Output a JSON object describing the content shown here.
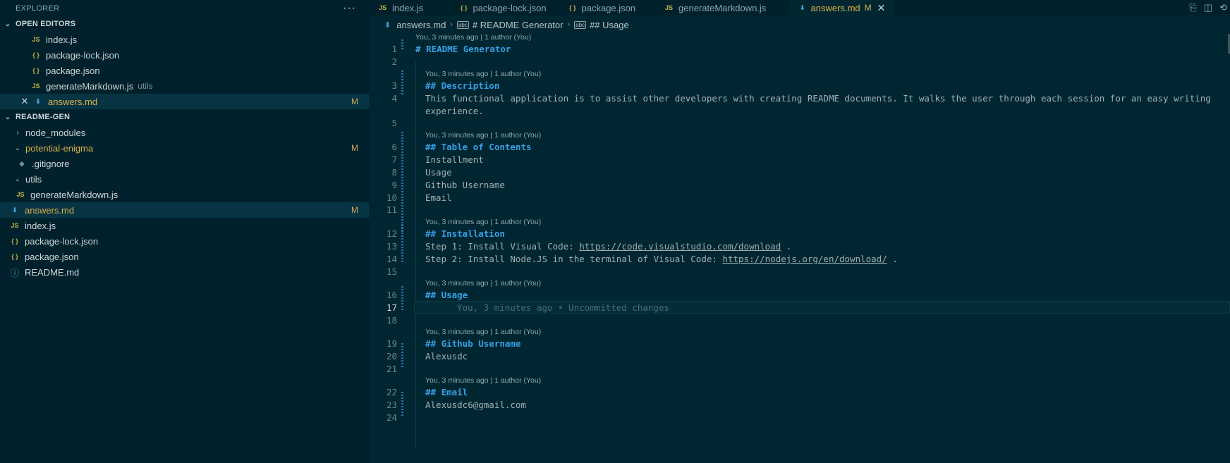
{
  "explorer": {
    "title": "EXPLORER",
    "more_label": "···",
    "open_editors": {
      "title": "OPEN EDITORS",
      "items": [
        {
          "icon": "JS",
          "name": "index.js",
          "desc": "",
          "badge": ""
        },
        {
          "icon": "{ }",
          "name": "package-lock.json",
          "desc": "",
          "badge": ""
        },
        {
          "icon": "{ }",
          "name": "package.json",
          "desc": "",
          "badge": ""
        },
        {
          "icon": "JS",
          "name": "generateMarkdown.js",
          "desc": "utils",
          "badge": ""
        },
        {
          "icon": "⬇",
          "name": "answers.md",
          "desc": "",
          "badge": "M"
        }
      ]
    },
    "project": {
      "title": "README-GEN",
      "items": [
        {
          "name": "node_modules",
          "badge": ""
        },
        {
          "name": "potential-enigma",
          "badge": "M"
        },
        {
          "icon": "◆",
          "name": ".gitignore",
          "badge": ""
        },
        {
          "name": "utils",
          "badge": ""
        },
        {
          "icon": "JS",
          "name": "generateMarkdown.js",
          "badge": ""
        },
        {
          "icon": "⬇",
          "name": "answers.md",
          "badge": "M"
        },
        {
          "icon": "JS",
          "name": "index.js",
          "badge": ""
        },
        {
          "icon": "{ }",
          "name": "package-lock.json",
          "badge": ""
        },
        {
          "icon": "{ }",
          "name": "package.json",
          "badge": ""
        },
        {
          "icon": "ⓘ",
          "name": "README.md",
          "badge": ""
        }
      ]
    }
  },
  "tabs": [
    {
      "icon": "JS",
      "label": "index.js"
    },
    {
      "icon": "{ }",
      "label": "package-lock.json"
    },
    {
      "icon": "{ }",
      "label": "package.json"
    },
    {
      "icon": "JS",
      "label": "generateMarkdown.js"
    },
    {
      "icon": "⬇",
      "label": "answers.md",
      "mark": "M",
      "close": "✕"
    }
  ],
  "breadcrumb": {
    "file": "answers.md",
    "h1": "# README Generator",
    "h2": "## Usage",
    "sep": "›"
  },
  "blame": {
    "lens": "You, 3 minutes ago | 1 author (You)",
    "inline": "You, 3 minutes ago • Uncommitted changes"
  },
  "editor": {
    "lines": {
      "l1": "# README Generator",
      "l3": "## Description",
      "l4": "This functional application is to assist other developers with creating README documents. It walks the user through each session for an easy writing",
      "l4b": "experience.",
      "l6": "## Table of Contents",
      "l7": "Installment",
      "l8": "Usage",
      "l9": "Github Username",
      "l10": "Email",
      "l12": "## Installation",
      "l13a": "Step 1: Install Visual Code: ",
      "l13link": "https://code.visualstudio.com/download",
      "l13b": " .",
      "l14a": "Step 2: Install Node.JS in the terminal of Visual Code: ",
      "l14link": "https://nodejs.org/en/download/",
      "l14b": " .",
      "l16": "## Usage",
      "l19": "## Github Username",
      "l20": "Alexusdc",
      "l22": "## Email",
      "l23": "Alexusdc6@gmail.com"
    },
    "numbers": [
      "1",
      "2",
      "3",
      "4",
      "5",
      "6",
      "7",
      "8",
      "9",
      "10",
      "11",
      "12",
      "13",
      "14",
      "15",
      "16",
      "17",
      "18",
      "19",
      "20",
      "21",
      "22",
      "23",
      "24"
    ]
  }
}
